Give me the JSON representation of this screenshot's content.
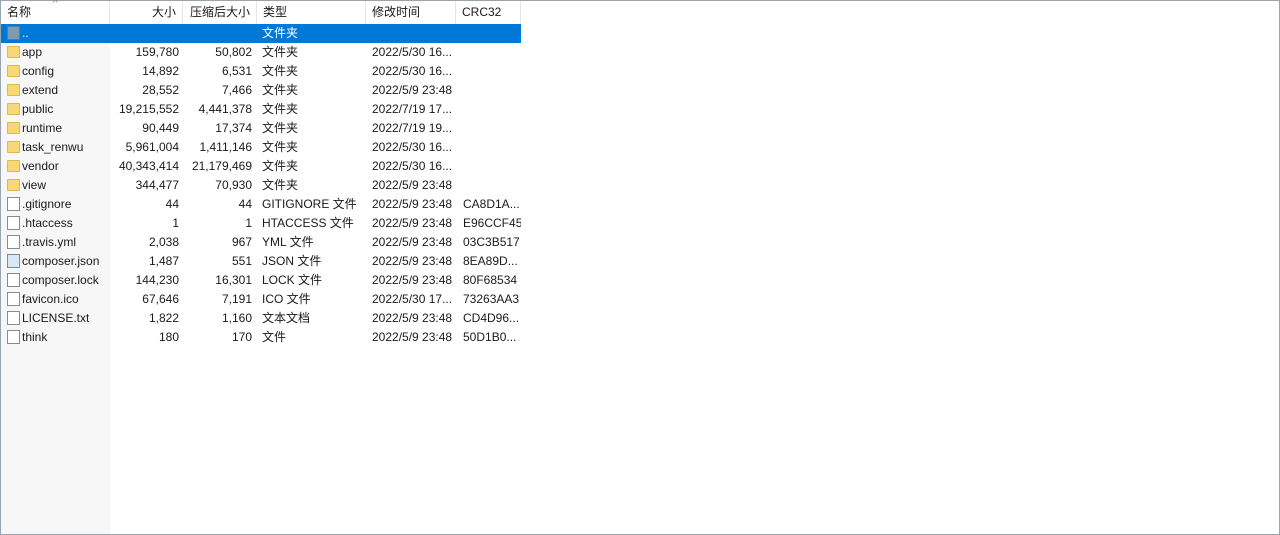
{
  "header": {
    "name": "名称",
    "size": "大小",
    "packed": "压缩后大小",
    "type": "类型",
    "modified": "修改时间",
    "crc": "CRC32",
    "sort_indicator": "^"
  },
  "rows": [
    {
      "name": "..",
      "size": "",
      "packed": "",
      "type": "文件夹",
      "modified": "",
      "crc": "",
      "icon": "parent-folder-icon",
      "selected": true
    },
    {
      "name": "app",
      "size": "159,780",
      "packed": "50,802",
      "type": "文件夹",
      "modified": "2022/5/30 16...",
      "crc": "",
      "icon": "folder-icon"
    },
    {
      "name": "config",
      "size": "14,892",
      "packed": "6,531",
      "type": "文件夹",
      "modified": "2022/5/30 16...",
      "crc": "",
      "icon": "folder-icon"
    },
    {
      "name": "extend",
      "size": "28,552",
      "packed": "7,466",
      "type": "文件夹",
      "modified": "2022/5/9 23:48",
      "crc": "",
      "icon": "folder-icon"
    },
    {
      "name": "public",
      "size": "19,215,552",
      "packed": "4,441,378",
      "type": "文件夹",
      "modified": "2022/7/19 17...",
      "crc": "",
      "icon": "folder-icon"
    },
    {
      "name": "runtime",
      "size": "90,449",
      "packed": "17,374",
      "type": "文件夹",
      "modified": "2022/7/19 19...",
      "crc": "",
      "icon": "folder-icon"
    },
    {
      "name": "task_renwu",
      "size": "5,961,004",
      "packed": "1,411,146",
      "type": "文件夹",
      "modified": "2022/5/30 16...",
      "crc": "",
      "icon": "folder-icon"
    },
    {
      "name": "vendor",
      "size": "40,343,414",
      "packed": "21,179,469",
      "type": "文件夹",
      "modified": "2022/5/30 16...",
      "crc": "",
      "icon": "folder-icon"
    },
    {
      "name": "view",
      "size": "344,477",
      "packed": "70,930",
      "type": "文件夹",
      "modified": "2022/5/9 23:48",
      "crc": "",
      "icon": "folder-icon"
    },
    {
      "name": ".gitignore",
      "size": "44",
      "packed": "44",
      "type": "GITIGNORE 文件",
      "modified": "2022/5/9 23:48",
      "crc": "CA8D1A...",
      "icon": "file-icon"
    },
    {
      "name": ".htaccess",
      "size": "1",
      "packed": "1",
      "type": "HTACCESS 文件",
      "modified": "2022/5/9 23:48",
      "crc": "E96CCF45",
      "icon": "file-icon"
    },
    {
      "name": ".travis.yml",
      "size": "2,038",
      "packed": "967",
      "type": "YML 文件",
      "modified": "2022/5/9 23:48",
      "crc": "03C3B517",
      "icon": "file-icon"
    },
    {
      "name": "composer.json",
      "size": "1,487",
      "packed": "551",
      "type": "JSON 文件",
      "modified": "2022/5/9 23:48",
      "crc": "8EA89D...",
      "icon": "json-file-icon"
    },
    {
      "name": "composer.lock",
      "size": "144,230",
      "packed": "16,301",
      "type": "LOCK 文件",
      "modified": "2022/5/9 23:48",
      "crc": "80F68534",
      "icon": "file-icon"
    },
    {
      "name": "favicon.ico",
      "size": "67,646",
      "packed": "7,191",
      "type": "ICO 文件",
      "modified": "2022/5/30 17...",
      "crc": "73263AA3",
      "icon": "file-icon"
    },
    {
      "name": "LICENSE.txt",
      "size": "1,822",
      "packed": "1,160",
      "type": "文本文档",
      "modified": "2022/5/9 23:48",
      "crc": "CD4D96...",
      "icon": "file-icon"
    },
    {
      "name": "think",
      "size": "180",
      "packed": "170",
      "type": "文件",
      "modified": "2022/5/9 23:48",
      "crc": "50D1B0...",
      "icon": "file-icon"
    }
  ],
  "colors": {
    "selection": "#0078d7",
    "folder": "#f8d775",
    "border": "#9aa4ae"
  }
}
